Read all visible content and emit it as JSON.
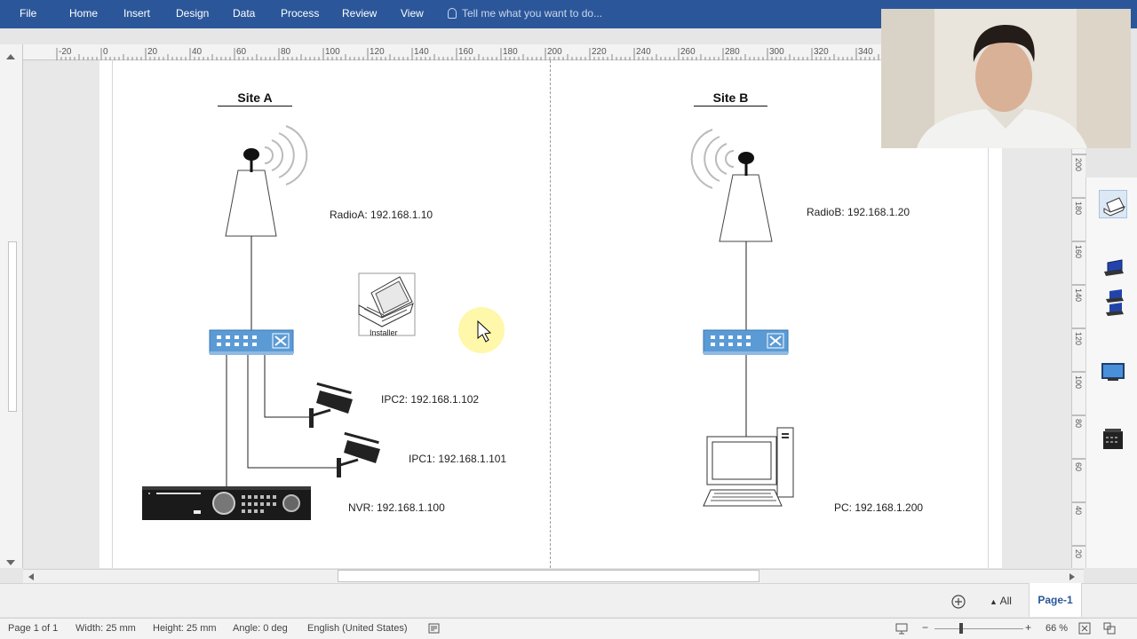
{
  "ribbon": {
    "tabs": [
      "File",
      "Home",
      "Insert",
      "Design",
      "Data",
      "Process",
      "Review",
      "View"
    ],
    "tell_me": "Tell me what you want to do..."
  },
  "ruler": {
    "top_ticks": [
      "-20",
      "0",
      "20",
      "40",
      "60",
      "80",
      "100",
      "120",
      "140",
      "160",
      "180",
      "200",
      "220",
      "240",
      "260",
      "280",
      "300",
      "320",
      "340"
    ],
    "right_ticks": [
      "200",
      "180",
      "160",
      "140",
      "120",
      "100",
      "80",
      "60",
      "40",
      "20"
    ]
  },
  "diagram": {
    "site_a": {
      "title": "Site A",
      "radio_label": "RadioA: 192.168.1.10",
      "installer_label": "Installer",
      "ipc2_label": "IPC2: 192.168.1.102",
      "ipc1_label": "IPC1: 192.168.1.101",
      "nvr_label": "NVR: 192.168.1.100"
    },
    "site_b": {
      "title": "Site B",
      "radio_label": "RadioB: 192.168.1.20",
      "pc_label": "PC: 192.168.1.200"
    }
  },
  "tabbar": {
    "all_label": "All",
    "page_tab": "Page-1"
  },
  "status": {
    "page": "Page 1 of 1",
    "width": "Width: 25 mm",
    "height": "Height: 25 mm",
    "angle": "Angle: 0 deg",
    "language": "English (United States)",
    "zoom": "66 %"
  },
  "colors": {
    "ribbon": "#2b579a",
    "switch_blue": "#5b9bd5",
    "cursor_highlight": "#fff6a0"
  }
}
